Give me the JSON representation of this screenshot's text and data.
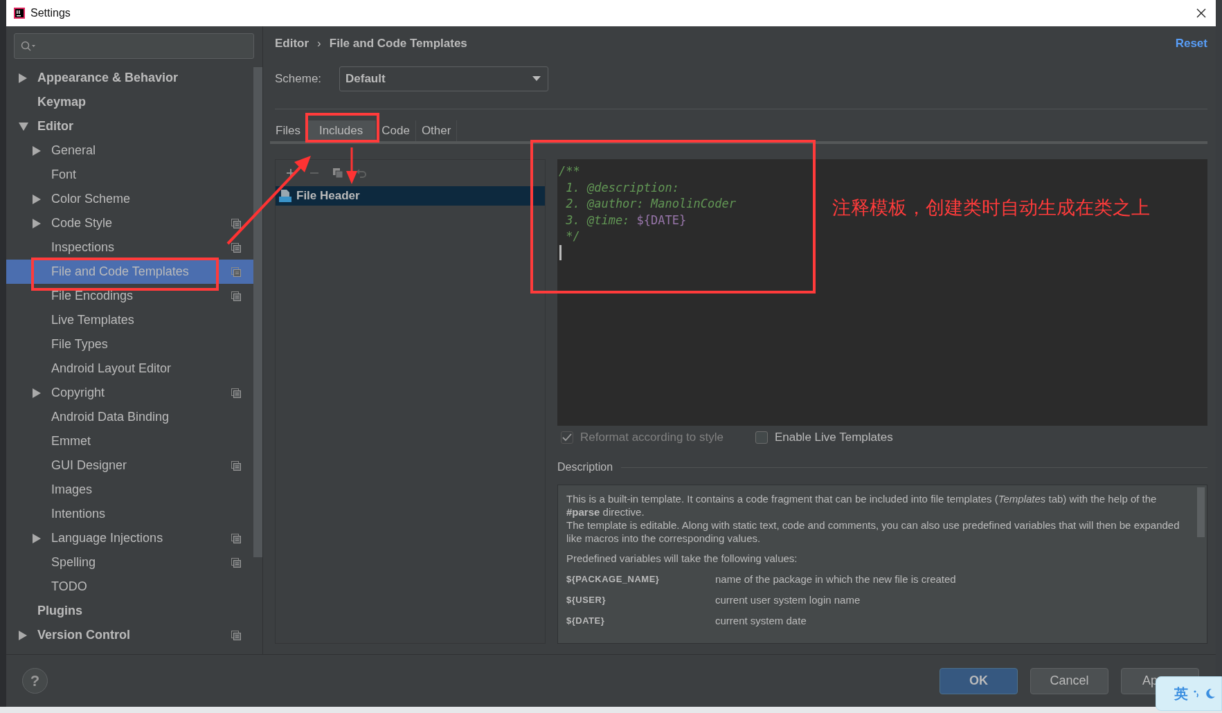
{
  "window": {
    "title": "Settings"
  },
  "sidebar": {
    "items": [
      {
        "label": "Appearance & Behavior",
        "expanded": false,
        "selected": false,
        "project_scoped": false
      },
      {
        "label": "Keymap",
        "selected": false,
        "project_scoped": false
      },
      {
        "label": "Editor",
        "expanded": true,
        "selected": false,
        "project_scoped": false,
        "children": [
          {
            "label": "General",
            "expanded": false,
            "selected": false,
            "project_scoped": false
          },
          {
            "label": "Font",
            "selected": false,
            "project_scoped": false
          },
          {
            "label": "Color Scheme",
            "expanded": false,
            "selected": false,
            "project_scoped": false
          },
          {
            "label": "Code Style",
            "expanded": false,
            "selected": false,
            "project_scoped": true
          },
          {
            "label": "Inspections",
            "selected": false,
            "project_scoped": true
          },
          {
            "label": "File and Code Templates",
            "selected": true,
            "project_scoped": true
          },
          {
            "label": "File Encodings",
            "selected": false,
            "project_scoped": true
          },
          {
            "label": "Live Templates",
            "selected": false,
            "project_scoped": false
          },
          {
            "label": "File Types",
            "selected": false,
            "project_scoped": false
          },
          {
            "label": "Android Layout Editor",
            "selected": false,
            "project_scoped": false
          },
          {
            "label": "Copyright",
            "expanded": false,
            "selected": false,
            "project_scoped": true
          },
          {
            "label": "Android Data Binding",
            "selected": false,
            "project_scoped": false
          },
          {
            "label": "Emmet",
            "selected": false,
            "project_scoped": false
          },
          {
            "label": "GUI Designer",
            "selected": false,
            "project_scoped": true
          },
          {
            "label": "Images",
            "selected": false,
            "project_scoped": false
          },
          {
            "label": "Intentions",
            "selected": false,
            "project_scoped": false
          },
          {
            "label": "Language Injections",
            "expanded": false,
            "selected": false,
            "project_scoped": true
          },
          {
            "label": "Spelling",
            "selected": false,
            "project_scoped": true
          },
          {
            "label": "TODO",
            "selected": false,
            "project_scoped": false
          }
        ]
      },
      {
        "label": "Plugins",
        "selected": false,
        "project_scoped": false
      },
      {
        "label": "Version Control",
        "expanded": false,
        "selected": false,
        "project_scoped": true
      }
    ]
  },
  "breadcrumb": {
    "items": [
      "Editor",
      "File and Code Templates"
    ],
    "separator": "›"
  },
  "reset_link": "Reset",
  "scheme": {
    "label": "Scheme:",
    "value": "Default"
  },
  "tabs": [
    {
      "label": "Files",
      "selected": false
    },
    {
      "label": "Includes",
      "selected": true
    },
    {
      "label": "Code",
      "selected": false
    },
    {
      "label": "Other",
      "selected": false
    }
  ],
  "templates": [
    {
      "label": "File Header",
      "selected": true
    }
  ],
  "editor": {
    "lines": [
      [
        {
          "text": "/**",
          "kind": "comment"
        }
      ],
      [
        {
          "text": " 1. @description:",
          "kind": "comment"
        }
      ],
      [
        {
          "text": " 2. @author: ManolinCoder",
          "kind": "comment"
        }
      ],
      [
        {
          "text": " 3. @time: ",
          "kind": "comment"
        },
        {
          "text": "${DATE}",
          "kind": "variable"
        }
      ],
      [
        {
          "text": " */",
          "kind": "comment"
        }
      ]
    ]
  },
  "options": [
    {
      "label": "Reformat according to style",
      "checked": true,
      "disabled": true
    },
    {
      "label": "Enable Live Templates",
      "checked": false,
      "disabled": false
    }
  ],
  "description": {
    "title": "Description",
    "paragraphs": [
      "This is a built-in template. It contains a code fragment that can be included into file templates (*Templates* tab) with the help of the **#parse** directive.",
      "The template is editable. Along with static text, code and comments, you can also use predefined variables that will then be expanded like macros into the corresponding values."
    ],
    "variables_intro": "Predefined variables will take the following values:",
    "variables": [
      {
        "name": "${PACKAGE_NAME}",
        "meaning": "name of the package in which the new file is created"
      },
      {
        "name": "${USER}",
        "meaning": "current user system login name"
      },
      {
        "name": "${DATE}",
        "meaning": "current system date"
      }
    ]
  },
  "help_button": "?",
  "buttons": [
    {
      "label": "OK",
      "kind": "primary"
    },
    {
      "label": "Cancel",
      "kind": "default"
    },
    {
      "label": "Ap",
      "kind": "default"
    }
  ],
  "ime_indicator": {
    "label": "英"
  },
  "annotation": {
    "note": "注释模板，创建类时自动生成在类之上"
  }
}
